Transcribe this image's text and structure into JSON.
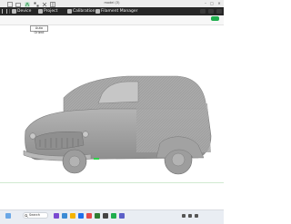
{
  "window": {
    "title": "model (3)"
  },
  "tabs": [
    {
      "label": "Device",
      "icon": "device-icon"
    },
    {
      "label": "Project",
      "icon": "project-icon"
    },
    {
      "label": "Calibration",
      "icon": "calibration-icon"
    },
    {
      "label": "Filament Manager",
      "icon": "filament-manager-icon"
    }
  ],
  "toolbar": {
    "tooltip": "Auto Orient"
  },
  "taskbar": {
    "search_placeholder": "Search"
  },
  "colors": {
    "tabbar_bg": "#262626",
    "model_gray": "#a7a7a7",
    "accent_green": "#1fae4e"
  }
}
